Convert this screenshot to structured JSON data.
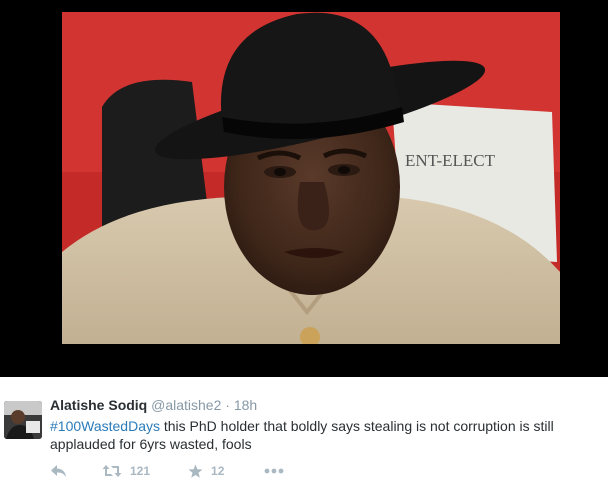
{
  "media": {
    "sign_text": "ENT-ELECT"
  },
  "tweet": {
    "fullname": "Alatishe Sodiq",
    "handle": "@alatishe2",
    "separator": "·",
    "timestamp": "18h",
    "hashtag": "#100WastedDays",
    "text_line1": " this PhD holder that boldly says stealing is not corruption is still",
    "text_line2": "applauded for 6yrs wasted, fools"
  },
  "actions": {
    "reply_icon": "reply-icon",
    "retweet_icon": "retweet-icon",
    "retweet_count": "121",
    "favorite_icon": "star-icon",
    "favorite_count": "12",
    "more_icon": "more-icon"
  },
  "colors": {
    "frame_background": "#000000",
    "hashtag": "#2b7bb9",
    "action_icons": "#aab8c2",
    "name": "#292f33",
    "meta": "#8899a6"
  }
}
